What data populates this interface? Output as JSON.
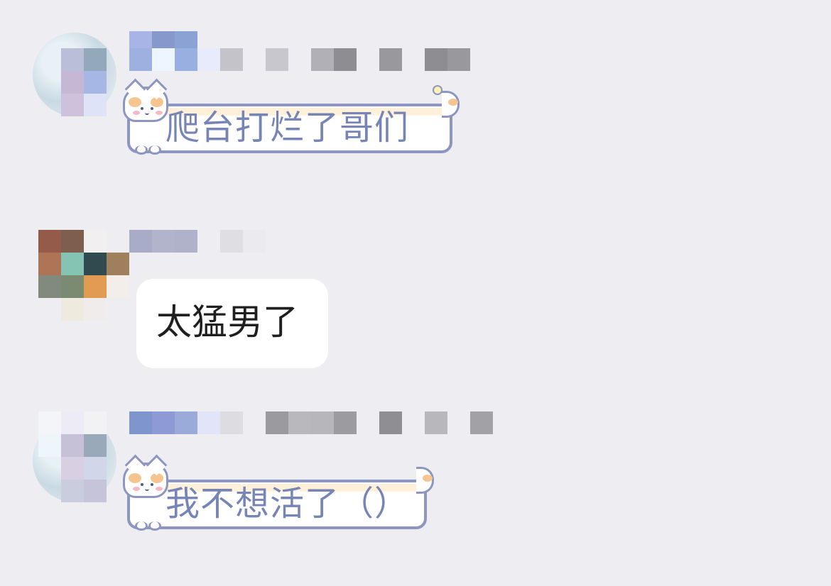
{
  "chat": {
    "messages": [
      {
        "text": "爬台打烂了哥们",
        "style": "cat-bubble"
      },
      {
        "text": "太猛男了",
        "style": "plain-bubble"
      },
      {
        "text": "我不想活了（）",
        "style": "cat-bubble"
      }
    ]
  },
  "colors": {
    "background": "#eeedf2",
    "cat_bubble_text": "#7685b5",
    "plain_bubble_text": "#1f1f1f",
    "bubble_border": "#8d95c1",
    "bubble_fill": "#ffffff"
  }
}
